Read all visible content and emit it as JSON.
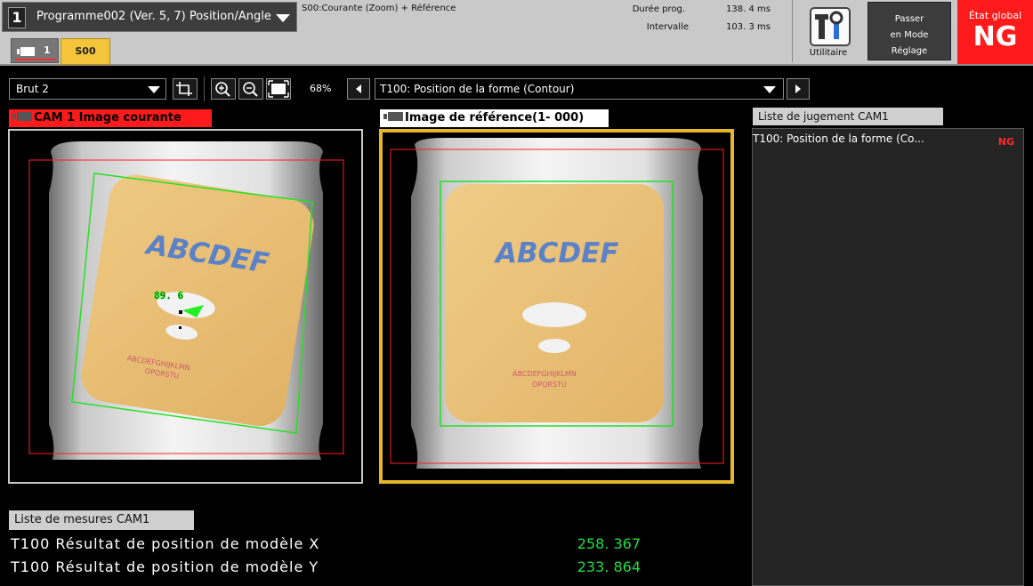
{
  "header": {
    "program_number": "1",
    "program_name": "Programme002 (Ver. 5, 7) Position/Angle",
    "status": "S00:Courante (Zoom) +  Référence",
    "duration_label": "Durée prog.",
    "duration_value": "138. 4  ms",
    "interval_label": "Intervalle",
    "interval_value": "103. 3  ms",
    "utility_label": "Utilitaire",
    "mode_button_lines": [
      "Passer",
      "en Mode",
      "Réglage"
    ],
    "global_state_label": "État global",
    "global_state_value": "NG"
  },
  "tabs": {
    "camera_tab": "1",
    "scene_tab": "S00"
  },
  "toolbar": {
    "image_mode": "Brut 2",
    "zoom": "68%",
    "tool": "T100: Position de la forme (Contour)"
  },
  "camera_view": {
    "title": "CAM 1 Image courante",
    "angle_readout": "89. 6",
    "label_text": "ABCDEF",
    "small_text_1": "ABCDEFGHIJKLMN",
    "small_text_2": "OPQRSTU"
  },
  "reference_view": {
    "title": "Image de référence(1- 000)",
    "label_text": "ABCDEF",
    "small_text_1": "ABCDEFGHIJKLMN",
    "small_text_2": "OPQRSTU"
  },
  "judgement": {
    "title": "Liste de jugement CAM1",
    "items": [
      {
        "label": "T100: Position de la forme (Co...",
        "result": "NG"
      }
    ]
  },
  "measurements": {
    "title": "Liste de mesures CAM1",
    "rows": [
      {
        "label": "T100 Résultat de position de modèle X",
        "value": "258. 367"
      },
      {
        "label": "T100 Résultat de position de modèle Y",
        "value": "233. 864"
      }
    ]
  },
  "colors": {
    "ng_red": "#ff1b1b",
    "tab_yellow": "#f4c43a",
    "value_green": "#22dd44",
    "ref_frame": "#e6b52a"
  }
}
